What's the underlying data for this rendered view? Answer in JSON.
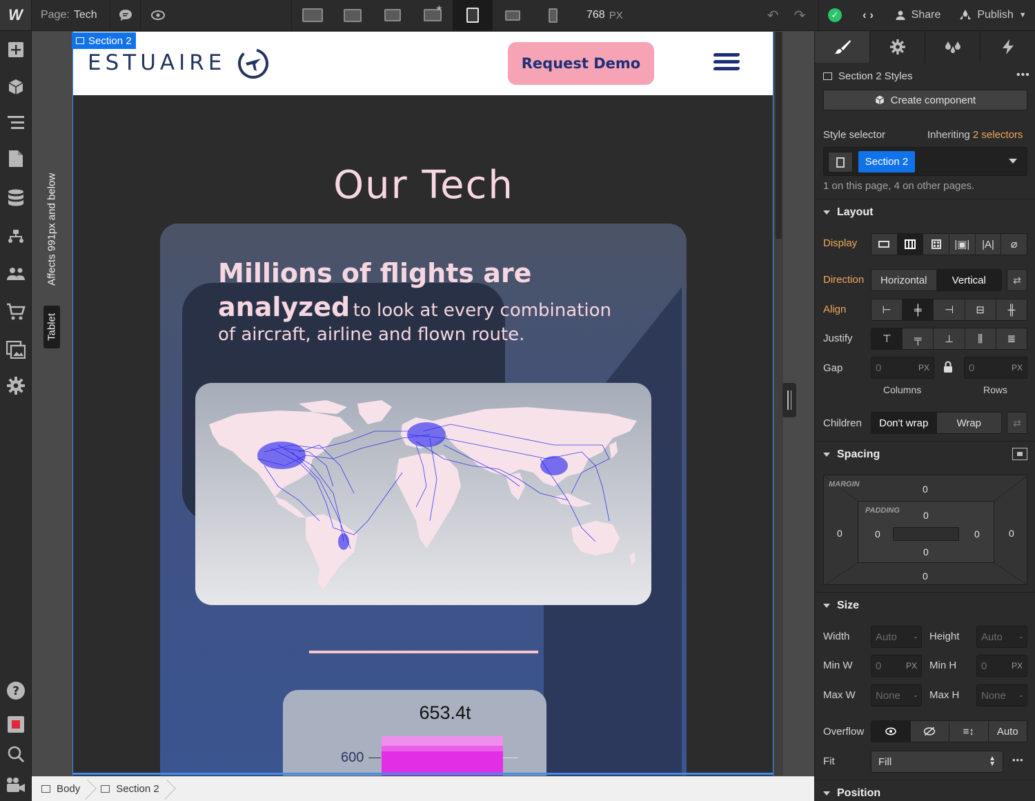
{
  "topbar": {
    "logo": "W",
    "page_prefix": "Page:",
    "page_name": "Tech",
    "width_value": "768",
    "width_unit": "PX",
    "share_label": "Share",
    "publish_label": "Publish"
  },
  "left_toolbar": {
    "items": [
      "add-icon",
      "components-icon",
      "navigator-icon",
      "pages-icon",
      "cms-icon",
      "logic-icon",
      "users-icon",
      "ecommerce-icon",
      "assets-icon",
      "settings-icon",
      "help-icon",
      "record-icon",
      "search-icon",
      "video-icon"
    ]
  },
  "canvas": {
    "affects_label": "Affects 991px and below",
    "breakpoint_tag": "Tablet",
    "selected_tag": "Section 2",
    "site": {
      "brand": "ESTUAIRE",
      "cta_label": "Request Demo",
      "hero_title": "Our Tech",
      "headline_big_1": "Millions of flights are",
      "headline_big_2": "analyzed",
      "headline_small_1": "to look at every combination",
      "headline_small_2": "of aircraft, airline and flown route.",
      "chart_value_label": "653.4t",
      "chart_tick_label": "600"
    }
  },
  "breadcrumb": {
    "items": [
      "Body",
      "Section 2"
    ]
  },
  "style_panel": {
    "header_title": "Section 2 Styles",
    "create_component": "Create component",
    "style_selector_label": "Style selector",
    "inheriting_prefix": "Inheriting",
    "inheriting_link": "2 selectors",
    "selector_chip": "Section 2",
    "usage_note": "1 on this page, 4 on other pages.",
    "layout": {
      "title": "Layout",
      "display_label": "Display",
      "direction_label": "Direction",
      "direction_options": [
        "Horizontal",
        "Vertical"
      ],
      "align_label": "Align",
      "justify_label": "Justify",
      "gap_label": "Gap",
      "gap_columns_value": "0",
      "gap_rows_value": "0",
      "gap_unit": "PX",
      "columns_label": "Columns",
      "rows_label": "Rows",
      "children_label": "Children",
      "children_options": [
        "Don't wrap",
        "Wrap"
      ]
    },
    "spacing": {
      "title": "Spacing",
      "margin_label": "MARGIN",
      "padding_label": "PADDING",
      "margin_top": "0",
      "margin_right": "0",
      "margin_bottom": "0",
      "margin_left": "0",
      "padding_top": "0",
      "padding_right": "0",
      "padding_bottom": "0",
      "padding_left": "0"
    },
    "size": {
      "title": "Size",
      "width_label": "Width",
      "width_value": "Auto",
      "height_label": "Height",
      "height_value": "Auto",
      "min_w_label": "Min W",
      "min_w_value": "0",
      "min_h_label": "Min H",
      "min_h_value": "0",
      "max_w_label": "Max W",
      "max_w_value": "None",
      "max_h_label": "Max H",
      "max_h_value": "None",
      "px": "PX",
      "dash": "-",
      "overflow_label": "Overflow",
      "overflow_auto": "Auto",
      "fit_label": "Fit",
      "fit_value": "Fill"
    },
    "position_title": "Position"
  },
  "colors": {
    "accent_blue": "#1173ea",
    "canvas_bg": "#2c2c2c",
    "brand_navy": "#24345f",
    "cta_pink": "#f6a3b5",
    "chart_magenta": "#e22fe6",
    "label_orange": "#f0a85a",
    "success_green": "#2bc46b"
  }
}
